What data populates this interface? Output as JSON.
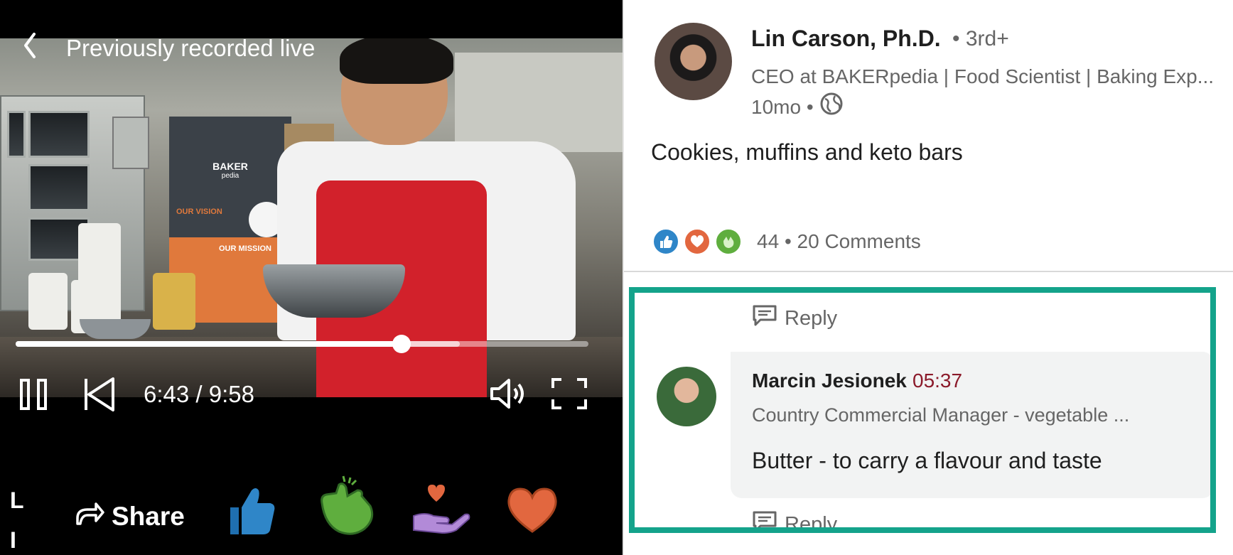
{
  "video": {
    "title": "Previously recorded live",
    "time": "6:43 / 9:58",
    "progress_fraction": 0.674,
    "buffered_fraction": 0.775,
    "side_letters": [
      "L",
      "I"
    ],
    "share_label": "Share",
    "banner_brand": "BAKER",
    "banner_brand_sub": "pedia",
    "banner_vision": "OUR VISION",
    "banner_mission": "OUR MISSION"
  },
  "icons": {
    "back": "chevron-left-icon",
    "pause": "pause-icon",
    "restart": "skip-back-icon",
    "volume": "volume-icon",
    "fullscreen": "fullscreen-icon",
    "share": "share-arrow-icon",
    "like": "thumbs-up-icon",
    "celebrate": "clapping-hands-icon",
    "support": "heart-in-hand-icon",
    "love": "heart-icon",
    "globe": "globe-icon",
    "reply": "comment-icon"
  },
  "post": {
    "author_name": "Lin Carson, Ph.D.",
    "author_degree": "• 3rd+",
    "author_headline": "CEO at BAKERpedia | Food Scientist | Baking Exp...",
    "age": "10mo •",
    "text": "Cookies, muffins and keto bars",
    "reaction_count": "44",
    "comment_count": "• 20 Comments"
  },
  "comments": {
    "reply_label": "Reply",
    "commenter_name": "Marcin Jesionek",
    "timestamp": "05:37",
    "commenter_headline": "Country Commercial Manager - vegetable ...",
    "text": "Butter - to carry a flavour and taste"
  },
  "colors": {
    "highlight": "#14a38b",
    "like_blue": "#2f86c8",
    "love_orange": "#e2673f",
    "celebrate_green": "#5fae3e",
    "timestamp": "#8b1a2a"
  }
}
